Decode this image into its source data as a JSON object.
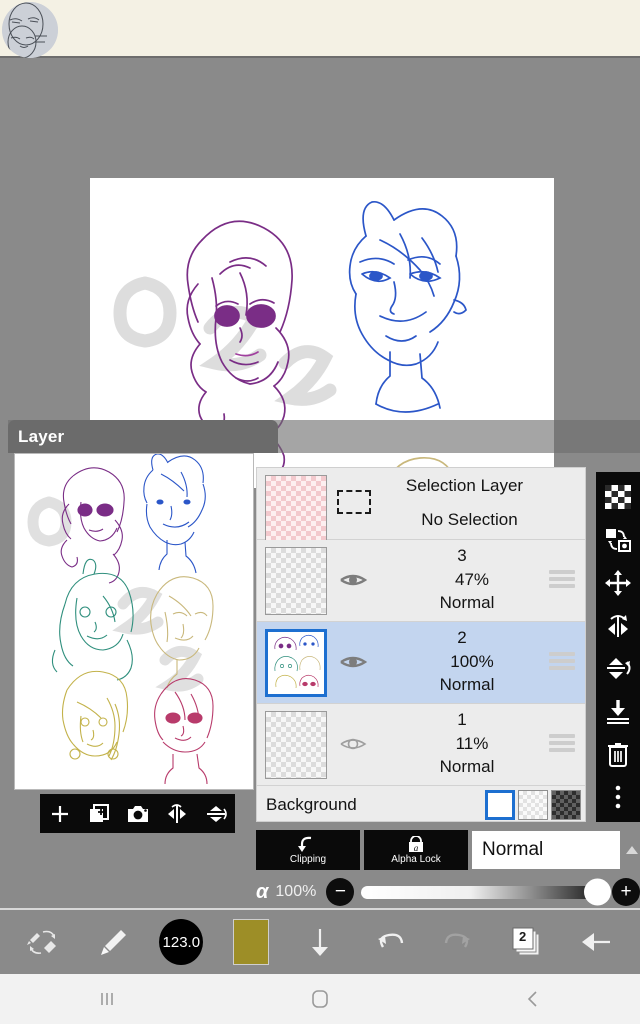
{
  "app": {
    "panel_title": "Layer",
    "top_banner_color": "#f4f1e4",
    "background_color": "#8a8a8a",
    "accent_color": "#1d6fd0",
    "selected_row_color": "#c3d5ef"
  },
  "avatar": {
    "name": "user-avatar"
  },
  "canvas": {
    "name": "drawing-canvas",
    "sketch_colors": [
      "#7a2d86",
      "#2b56c8"
    ],
    "watermark_text": "as"
  },
  "preview": {
    "name": "layer-preview",
    "sketch_colors": [
      "#7a2d86",
      "#2b56c8",
      "#2f8f7d",
      "#c9b87c",
      "#c3b24a",
      "#b83b6b"
    ]
  },
  "preview_toolbar": {
    "buttons": [
      {
        "label": "Add layer",
        "icon": "plus-icon"
      },
      {
        "label": "Duplicate layer",
        "icon": "duplicate-icon"
      },
      {
        "label": "Camera",
        "icon": "camera-icon"
      },
      {
        "label": "Flip horizontal",
        "icon": "flip-horizontal-icon"
      },
      {
        "label": "Flip vertical",
        "icon": "flip-vertical-icon"
      }
    ]
  },
  "selection_layer": {
    "title": "Selection Layer",
    "state": "No Selection"
  },
  "layers": [
    {
      "name": "3",
      "opacity": "47%",
      "blend": "Normal",
      "visible": true,
      "selected": false
    },
    {
      "name": "2",
      "opacity": "100%",
      "blend": "Normal",
      "visible": true,
      "selected": true
    },
    {
      "name": "1",
      "opacity": "11%",
      "blend": "Normal",
      "visible": false,
      "selected": false
    }
  ],
  "background": {
    "label": "Background",
    "swatches": [
      {
        "type": "white",
        "active": true
      },
      {
        "type": "checker",
        "active": false
      },
      {
        "type": "dark-checker",
        "active": false
      }
    ]
  },
  "side_rail": {
    "buttons": [
      {
        "label": "Transparency",
        "icon": "checker-icon"
      },
      {
        "label": "Transform swap",
        "icon": "transform-swap-icon"
      },
      {
        "label": "Move",
        "icon": "move-icon"
      },
      {
        "label": "Flip horizontal",
        "icon": "flip-horizontal-icon"
      },
      {
        "label": "Flip vertical",
        "icon": "flip-vertical-icon"
      },
      {
        "label": "Merge down",
        "icon": "merge-down-icon"
      },
      {
        "label": "Delete layer",
        "icon": "trash-icon"
      },
      {
        "label": "More options",
        "icon": "more-vertical-icon"
      }
    ]
  },
  "blend_controls": {
    "clipping_label": "Clipping",
    "alpha_lock_label": "Alpha Lock",
    "blend_mode": "Normal"
  },
  "alpha": {
    "symbol": "α",
    "value": "100%",
    "minus_label": "−",
    "plus_label": "+"
  },
  "bottom_toolbar": {
    "items": [
      {
        "label": "Swap brush eraser",
        "icon": "brush-eraser-swap-icon"
      },
      {
        "label": "Brush",
        "icon": "brush-icon"
      },
      {
        "label": "Brush size",
        "icon": "brush-size-icon",
        "value": "123.0"
      },
      {
        "label": "Color",
        "icon": "color-swatch-icon",
        "value": "#9d8e27"
      },
      {
        "label": "Download",
        "icon": "arrow-down-icon"
      },
      {
        "label": "Undo",
        "icon": "undo-icon"
      },
      {
        "label": "Redo",
        "icon": "redo-icon"
      },
      {
        "label": "Layers",
        "icon": "layers-icon",
        "value": "2"
      },
      {
        "label": "Back",
        "icon": "arrow-left-icon"
      }
    ]
  },
  "nav_bar": {
    "buttons": [
      {
        "label": "Recents",
        "icon": "recents-icon"
      },
      {
        "label": "Home",
        "icon": "home-icon"
      },
      {
        "label": "Back",
        "icon": "back-icon"
      }
    ]
  }
}
